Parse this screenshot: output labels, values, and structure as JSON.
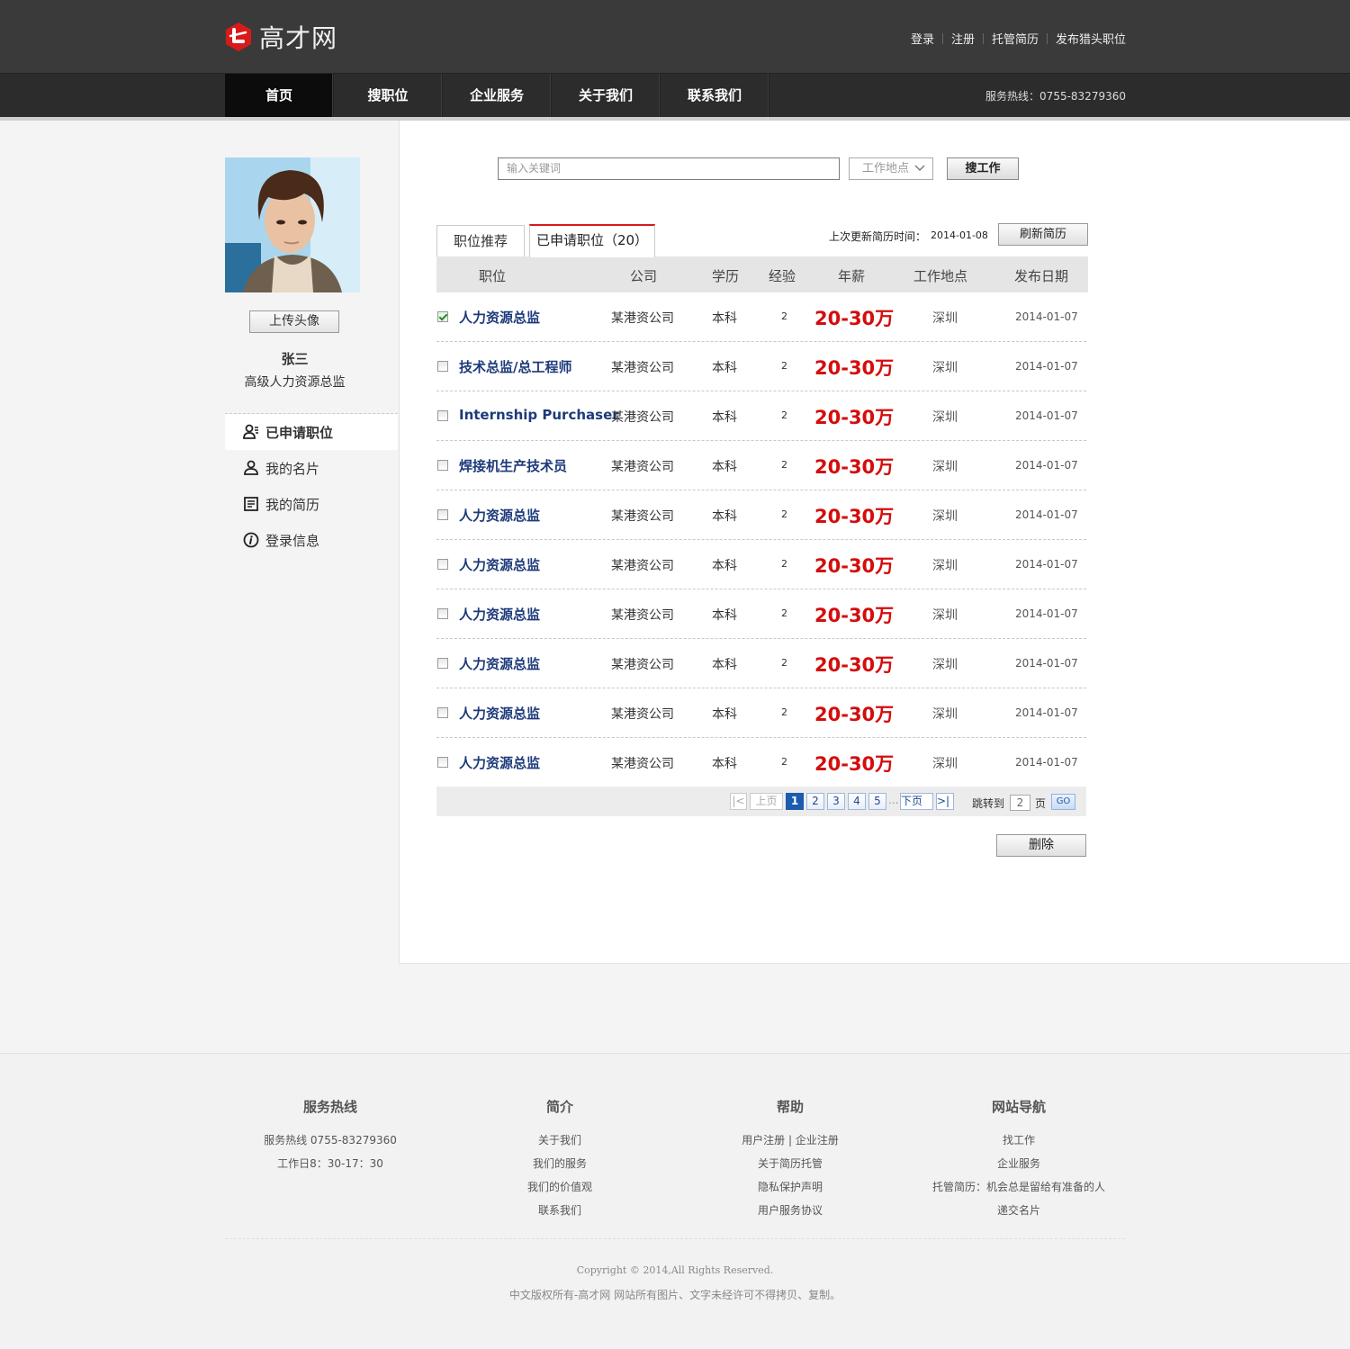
{
  "header": {
    "logo_text": "高才网",
    "top_links": [
      "登录",
      "注册",
      "托管简历",
      "发布猎头职位"
    ],
    "nav": [
      "首页",
      "搜职位",
      "企业服务",
      "关于我们",
      "联系我们"
    ],
    "hotline": "服务热线：0755-83279360",
    "accent_color": "#d81a1a"
  },
  "sidebar": {
    "upload_label": "上传头像",
    "name": "张三",
    "title": "高级人力资源总监",
    "menu": [
      {
        "label": "已申请职位",
        "icon": "user-list-icon",
        "active": true
      },
      {
        "label": "我的名片",
        "icon": "user-icon",
        "active": false
      },
      {
        "label": "我的简历",
        "icon": "document-icon",
        "active": false
      },
      {
        "label": "登录信息",
        "icon": "info-icon",
        "active": false
      }
    ]
  },
  "search": {
    "placeholder": "输入关键词",
    "location": "工作地点",
    "button": "搜工作"
  },
  "tabs": {
    "recommend": "职位推荐",
    "applied": "已申请职位（20）"
  },
  "update": {
    "label": "上次更新简历时间：",
    "date": "2014-01-08",
    "refresh": "刷新简历"
  },
  "table": {
    "headers": [
      "职位",
      "公司",
      "学历",
      "经验",
      "年薪",
      "工作地点",
      "发布日期"
    ],
    "rows": [
      {
        "title": "人力资源总监",
        "company": "某港资公司",
        "edu": "本科",
        "exp": "2",
        "salary": "20-30万",
        "loc": "深圳",
        "date": "2014-01-07",
        "checked": true
      },
      {
        "title": "技术总监/总工程师",
        "company": "某港资公司",
        "edu": "本科",
        "exp": "2",
        "salary": "20-30万",
        "loc": "深圳",
        "date": "2014-01-07",
        "checked": false
      },
      {
        "title": "Internship Purchaser",
        "company": "某港资公司",
        "edu": "本科",
        "exp": "2",
        "salary": "20-30万",
        "loc": "深圳",
        "date": "2014-01-07",
        "checked": false
      },
      {
        "title": "焊接机生产技术员",
        "company": "某港资公司",
        "edu": "本科",
        "exp": "2",
        "salary": "20-30万",
        "loc": "深圳",
        "date": "2014-01-07",
        "checked": false
      },
      {
        "title": "人力资源总监",
        "company": "某港资公司",
        "edu": "本科",
        "exp": "2",
        "salary": "20-30万",
        "loc": "深圳",
        "date": "2014-01-07",
        "checked": false
      },
      {
        "title": "人力资源总监",
        "company": "某港资公司",
        "edu": "本科",
        "exp": "2",
        "salary": "20-30万",
        "loc": "深圳",
        "date": "2014-01-07",
        "checked": false
      },
      {
        "title": "人力资源总监",
        "company": "某港资公司",
        "edu": "本科",
        "exp": "2",
        "salary": "20-30万",
        "loc": "深圳",
        "date": "2014-01-07",
        "checked": false
      },
      {
        "title": "人力资源总监",
        "company": "某港资公司",
        "edu": "本科",
        "exp": "2",
        "salary": "20-30万",
        "loc": "深圳",
        "date": "2014-01-07",
        "checked": false
      },
      {
        "title": "人力资源总监",
        "company": "某港资公司",
        "edu": "本科",
        "exp": "2",
        "salary": "20-30万",
        "loc": "深圳",
        "date": "2014-01-07",
        "checked": false
      },
      {
        "title": "人力资源总监",
        "company": "某港资公司",
        "edu": "本科",
        "exp": "2",
        "salary": "20-30万",
        "loc": "深圳",
        "date": "2014-01-07",
        "checked": false
      }
    ]
  },
  "pager": {
    "first": "|<",
    "prev": "上页",
    "pages": [
      "1",
      "2",
      "3",
      "4",
      "5"
    ],
    "current": "1",
    "ellipsis": "...",
    "next": "下页",
    "last": ">|",
    "jump_label": "跳转到",
    "jump_value": "2",
    "page_unit": "页",
    "go": "GO"
  },
  "delete_label": "删除",
  "footer": {
    "columns": [
      {
        "title": "服务热线",
        "items": [
          "服务热线 0755-83279360",
          "工作日8：30-17：30"
        ]
      },
      {
        "title": "简介",
        "items": [
          "关于我们",
          "我们的服务",
          "我们的价值观",
          "联系我们"
        ]
      },
      {
        "title": "帮助",
        "items": [
          "用户注册 | 企业注册",
          "关于简历托管",
          "隐私保护声明",
          "用户服务协议"
        ]
      },
      {
        "title": "网站导航",
        "items": [
          "找工作",
          "企业服务",
          "托管简历：机会总是留给有准备的人",
          "递交名片"
        ]
      }
    ],
    "copyright": "Copyright © 2014,All Rights Reserved.",
    "notice": "中文版权所有-高才网 网站所有图片、文字未经许可不得拷贝、复制。"
  }
}
